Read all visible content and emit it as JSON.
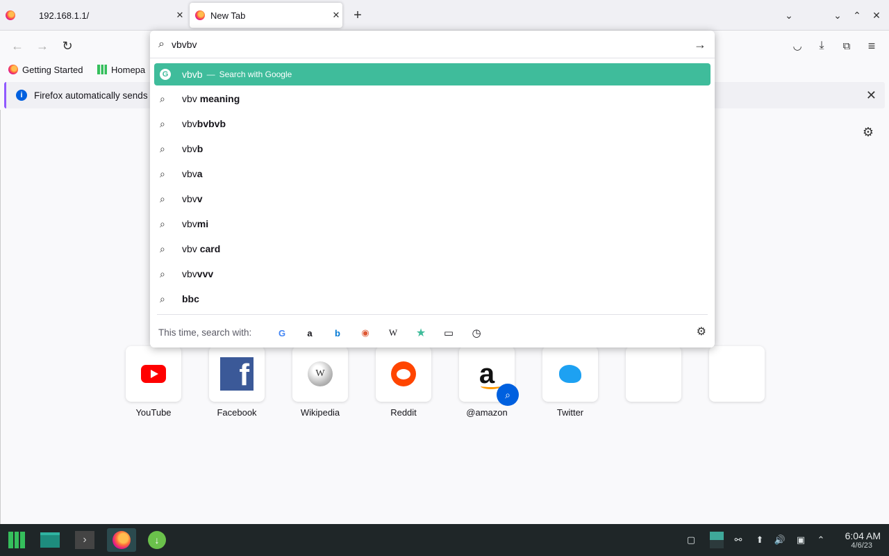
{
  "tabs": [
    {
      "title": "192.168.1.1/"
    },
    {
      "title": "New Tab"
    }
  ],
  "urlbar": {
    "value": "vbvbv",
    "suggestions": [
      {
        "plain": "vbvb",
        "bold": "",
        "action": "Search with Google",
        "selected": true
      },
      {
        "plain": "vbv ",
        "bold": "meaning"
      },
      {
        "plain": "vbv",
        "bold": "bvbvb"
      },
      {
        "plain": "vbv",
        "bold": "b"
      },
      {
        "plain": "vbv",
        "bold": "a"
      },
      {
        "plain": "vbv",
        "bold": "v"
      },
      {
        "plain": "vbv",
        "bold": "mi"
      },
      {
        "plain": "vbv ",
        "bold": "card"
      },
      {
        "plain": "vbv",
        "bold": "vvv"
      },
      {
        "plain": "",
        "bold": "bbc"
      }
    ],
    "oneoff_label": "This time, search with:",
    "engines": [
      "google-icon",
      "amazon-icon",
      "bing-icon",
      "duckduckgo-icon",
      "wikipedia-icon",
      "bookmarks-icon",
      "tabs-icon",
      "history-icon"
    ]
  },
  "bookmarks": [
    {
      "label": "Getting Started"
    },
    {
      "label": "Homepa"
    }
  ],
  "notification": {
    "text": "Firefox automatically sends"
  },
  "top_sites": [
    {
      "label": "YouTube"
    },
    {
      "label": "Facebook"
    },
    {
      "label": "Wikipedia"
    },
    {
      "label": "Reddit"
    },
    {
      "label": "@amazon"
    },
    {
      "label": "Twitter"
    }
  ],
  "taskbar": {
    "time": "6:04 AM",
    "date": "4/6/23"
  },
  "colors": {
    "accent": "#3fbc9b",
    "taskbar": "#1f2628"
  }
}
